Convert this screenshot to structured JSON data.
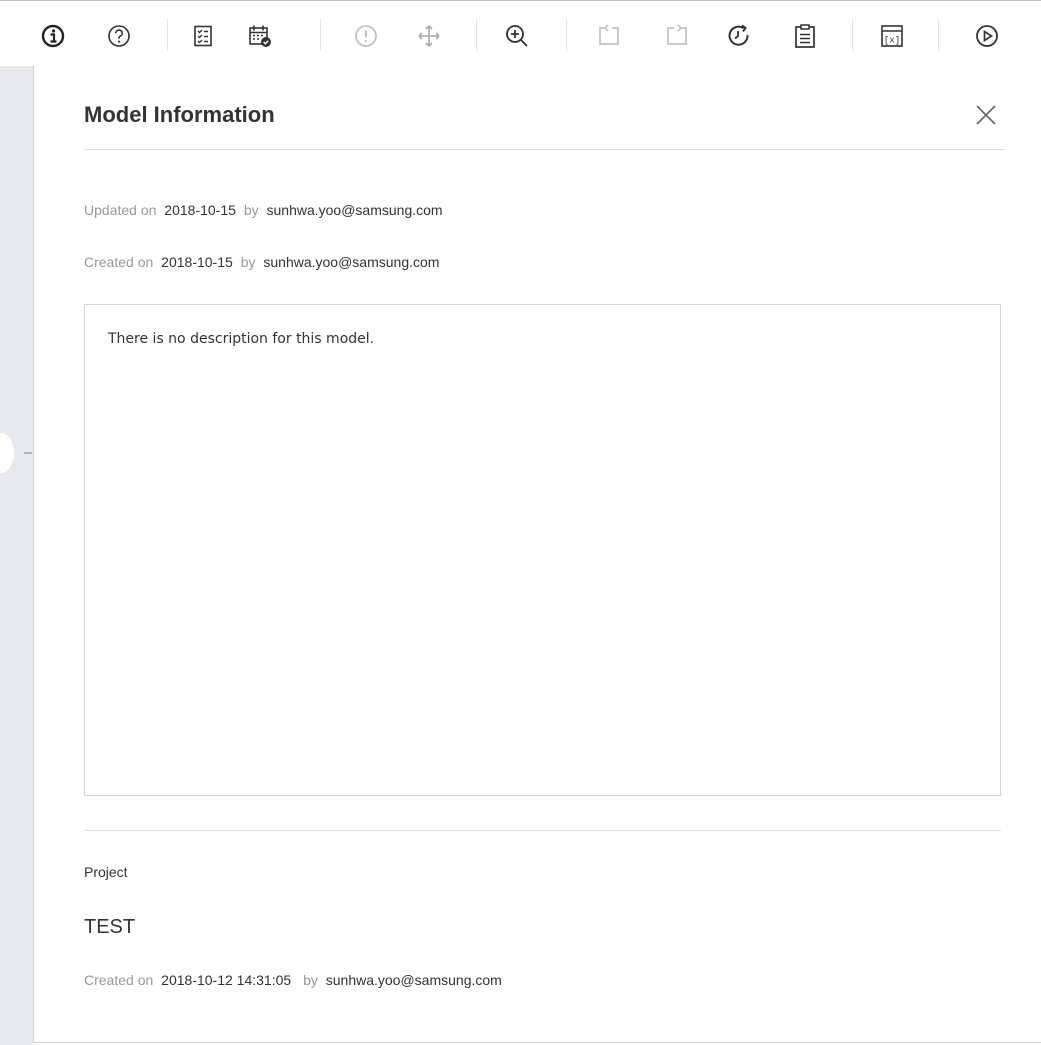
{
  "toolbar": {
    "buttons": [
      {
        "icon": "info-icon"
      },
      {
        "icon": "help-icon"
      },
      {
        "icon": "checklist-icon"
      },
      {
        "icon": "calendar-check-icon"
      },
      {
        "icon": "warning-icon"
      },
      {
        "icon": "move-icon"
      },
      {
        "icon": "zoom-in-icon"
      },
      {
        "icon": "undo-icon"
      },
      {
        "icon": "redo-icon"
      },
      {
        "icon": "refresh-icon"
      },
      {
        "icon": "clipboard-icon"
      },
      {
        "icon": "variable-icon"
      },
      {
        "icon": "play-icon"
      }
    ]
  },
  "panel": {
    "title": "Model Information",
    "updated": {
      "prefix": "Updated on",
      "date": "2018-10-15",
      "by_label": "by",
      "user": "sunhwa.yoo@samsung.com"
    },
    "created": {
      "prefix": "Created on",
      "date": "2018-10-15",
      "by_label": "by",
      "user": "sunhwa.yoo@samsung.com"
    },
    "description": "There is no description for this model.",
    "project": {
      "label": "Project",
      "name": "TEST",
      "created_prefix": "Created on",
      "created_datetime": "2018-10-12 14:31:05",
      "by_label": "by",
      "user": "sunhwa.yoo@samsung.com"
    }
  },
  "colors": {
    "icon_active": "#333333",
    "icon_disabled": "#bbbbbb",
    "muted_text": "#999999",
    "side_strip": "#e7e9ee"
  }
}
